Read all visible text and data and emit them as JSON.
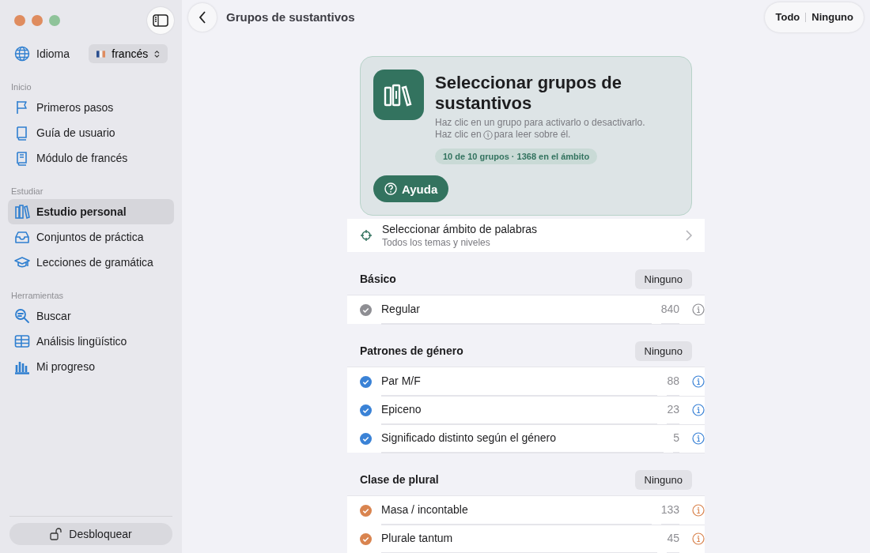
{
  "sidebar": {
    "language": {
      "label": "Idioma",
      "value": "francés"
    },
    "sections": [
      {
        "title": "Inicio",
        "items": [
          {
            "label": "Primeros pasos",
            "selected": false
          },
          {
            "label": "Guía de usuario",
            "selected": false
          },
          {
            "label": "Módulo de francés",
            "selected": false
          }
        ]
      },
      {
        "title": "Estudiar",
        "items": [
          {
            "label": "Estudio personal",
            "selected": true
          },
          {
            "label": "Conjuntos de práctica",
            "selected": false
          },
          {
            "label": "Lecciones de gramática",
            "selected": false
          }
        ]
      },
      {
        "title": "Herramientas",
        "items": [
          {
            "label": "Buscar",
            "selected": false
          },
          {
            "label": "Análisis lingüístico",
            "selected": false
          },
          {
            "label": "Mi progreso",
            "selected": false
          }
        ]
      }
    ],
    "unlock_button": "Desbloquear"
  },
  "toolbar": {
    "title": "Grupos de sustantivos",
    "all_button": "Todo",
    "none_button": "Ninguno"
  },
  "header_card": {
    "title": "Seleccionar grupos de sustantivos",
    "hint_line_1": "Haz clic en un grupo para activarlo o desactivarlo.",
    "hint_line_2_before": "Haz clic en",
    "hint_line_2_after": "para leer sobre él.",
    "badge": "10 de 10 grupos · 1368 en el ámbito",
    "help_button": "Ayuda"
  },
  "scope_row": {
    "title": "Seleccionar ámbito de palabras",
    "subtitle": "Todos los temas y niveles"
  },
  "groups": [
    {
      "title": "Básico",
      "none_button": "Ninguno",
      "color": "#8e8e93",
      "items": [
        {
          "label": "Regular",
          "count": "840",
          "checked": true
        }
      ]
    },
    {
      "title": "Patrones de género",
      "none_button": "Ninguno",
      "color": "#3a82d6",
      "items": [
        {
          "label": "Par M/F",
          "count": "88",
          "checked": true
        },
        {
          "label": "Epiceno",
          "count": "23",
          "checked": true
        },
        {
          "label": "Significado distinto según el género",
          "count": "5",
          "checked": true
        }
      ]
    },
    {
      "title": "Clase de plural",
      "none_button": "Ninguno",
      "color": "#d9844f",
      "items": [
        {
          "label": "Masa / incontable",
          "count": "133",
          "checked": true
        },
        {
          "label": "Plurale tantum",
          "count": "45",
          "checked": true
        }
      ]
    }
  ]
}
